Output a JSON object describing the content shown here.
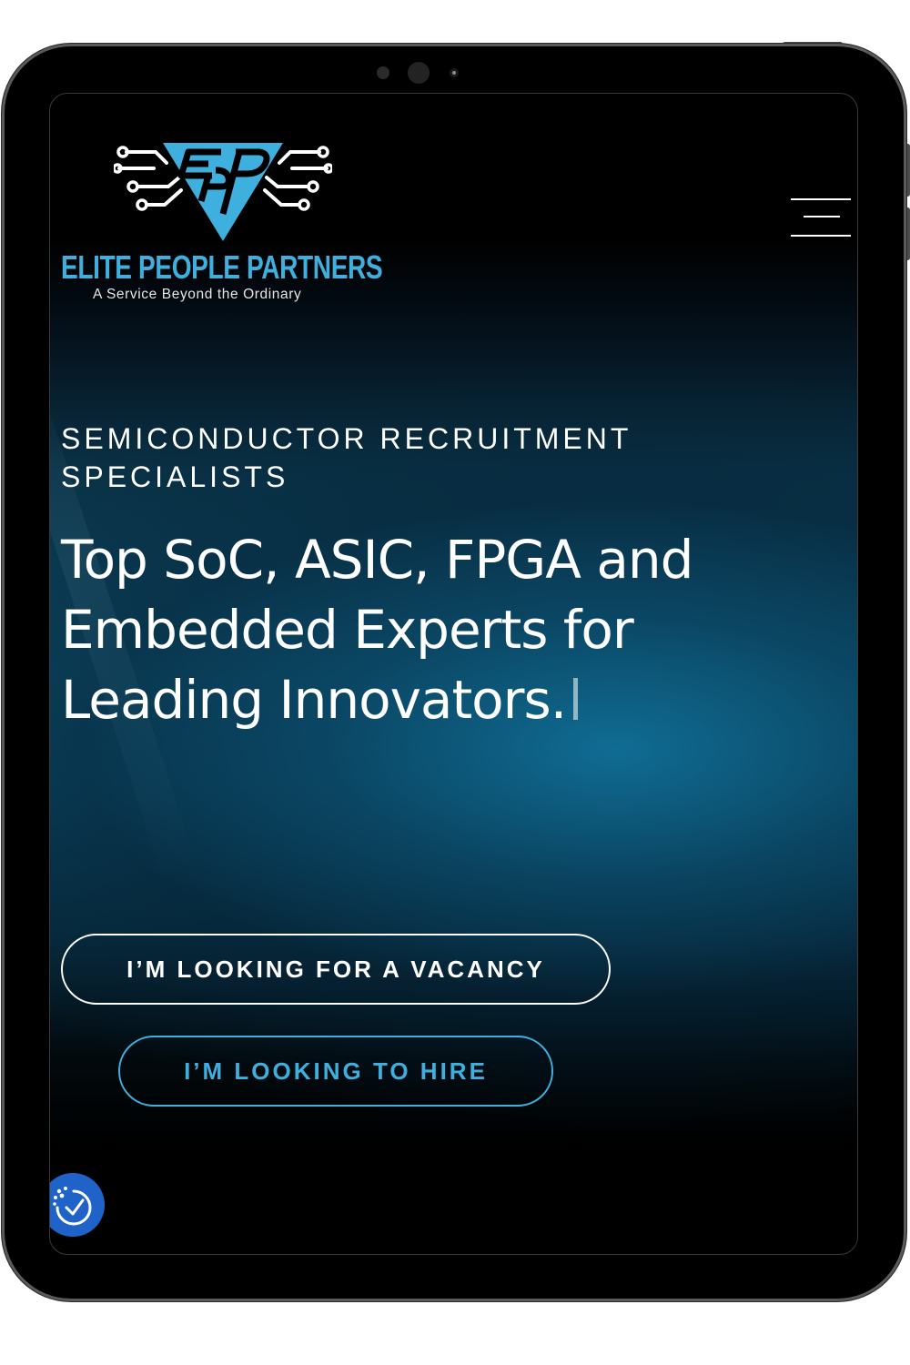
{
  "header": {
    "brand_name": "ELITE PEOPLE PARTNERS",
    "tagline": "A Service Beyond the Ordinary",
    "logo_icon": "circuit-triangle-epp-logo",
    "menu_icon": "hamburger-menu-icon"
  },
  "hero": {
    "eyebrow": "SEMICONDUCTOR RECRUITMENT SPECIALISTS",
    "headline": "Top SoC, ASIC, FPGA and Embedded Experts for Leading Innovators."
  },
  "actions": {
    "vacancy_label": "I’M LOOKING FOR A VACANCY",
    "hire_label": "I’M LOOKING TO HIRE"
  },
  "widgets": {
    "accessibility_icon": "accessibility-check-icon"
  },
  "colors": {
    "accent": "#3fb0de",
    "accessibility_button": "#1f63c9",
    "background": "#000000"
  }
}
